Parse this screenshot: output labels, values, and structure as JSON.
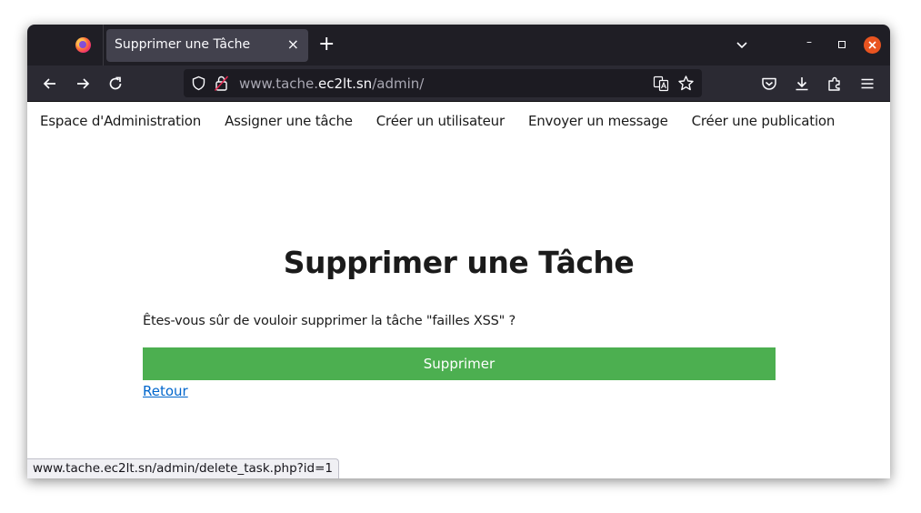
{
  "browser": {
    "tab_title": "Supprimer une Tâche",
    "tab_close": "×",
    "new_tab": "+",
    "url_prefix": "www.tache.",
    "url_domain": "ec2lt.sn",
    "url_path": "/admin/",
    "status_url": "www.tache.ec2lt.sn/admin/delete_task.php?id=1"
  },
  "nav": {
    "items": [
      "Espace d'Administration",
      "Assigner une tâche",
      "Créer un utilisateur",
      "Envoyer un message",
      "Créer une publication"
    ]
  },
  "page": {
    "title": "Supprimer une Tâche",
    "question": "Êtes-vous sûr de vouloir supprimer la tâche \"failles XSS\" ?",
    "delete_button": "Supprimer",
    "back_link": "Retour"
  },
  "colors": {
    "delete_button": "#4caf50",
    "link": "#0066cc",
    "window_close": "#e95420"
  }
}
